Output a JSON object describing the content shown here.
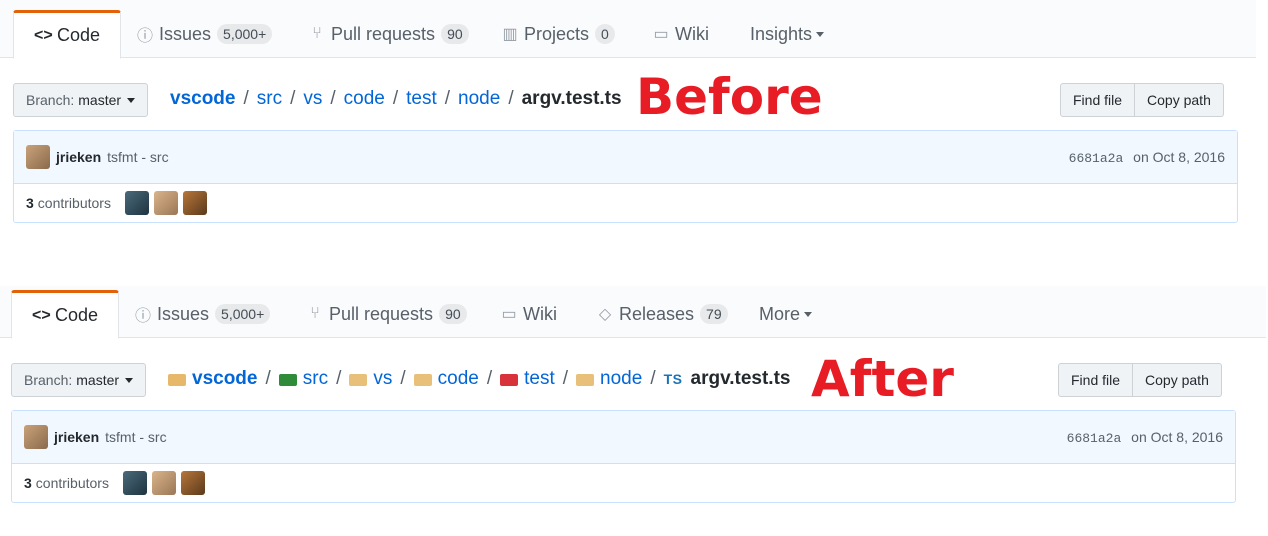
{
  "before": {
    "marker": "Before",
    "tabs": [
      {
        "label": "Code",
        "icon": "code-icon",
        "glyph": "<>",
        "counter": "",
        "selected": true
      },
      {
        "label": "Issues",
        "icon": "issue-icon",
        "glyph": "ⓘ",
        "counter": "5,000+"
      },
      {
        "label": "Pull requests",
        "icon": "pull-request-icon",
        "glyph": "⑂",
        "counter": "90"
      },
      {
        "label": "Projects",
        "icon": "project-icon",
        "glyph": "▥",
        "counter": "0"
      },
      {
        "label": "Wiki",
        "icon": "book-icon",
        "glyph": "▭",
        "counter": ""
      },
      {
        "label": "Insights",
        "icon": "",
        "glyph": "",
        "counter": "",
        "dropdown": true
      }
    ],
    "branch": {
      "prefix": "Branch:",
      "name": "master"
    },
    "breadcrumb": [
      "vscode",
      "src",
      "vs",
      "code",
      "test",
      "node"
    ],
    "file": "argv.test.ts",
    "buttons": {
      "find_file": "Find file",
      "copy_path": "Copy path"
    },
    "commit": {
      "author": "jrieken",
      "message": "tsfmt - src",
      "sha": "6681a2a",
      "date": "on Oct 8, 2016"
    },
    "contributors": {
      "count": "3",
      "label": "contributors"
    }
  },
  "after": {
    "marker": "After",
    "tabs": [
      {
        "label": "Code",
        "icon": "code-icon",
        "glyph": "<>",
        "counter": "",
        "selected": true
      },
      {
        "label": "Issues",
        "icon": "issue-icon",
        "glyph": "ⓘ",
        "counter": "5,000+"
      },
      {
        "label": "Pull requests",
        "icon": "pull-request-icon",
        "glyph": "⑂",
        "counter": "90"
      },
      {
        "label": "Wiki",
        "icon": "book-icon",
        "glyph": "▭",
        "counter": ""
      },
      {
        "label": "Releases",
        "icon": "tag-icon",
        "glyph": "◇",
        "counter": "79"
      },
      {
        "label": "More",
        "icon": "",
        "glyph": "",
        "counter": "",
        "dropdown": true
      }
    ],
    "branch": {
      "prefix": "Branch:",
      "name": "master"
    },
    "breadcrumb": [
      "vscode",
      "src",
      "vs",
      "code",
      "test",
      "node"
    ],
    "folder_icons": [
      "folder-vscode-icon",
      "folder-src-icon",
      "folder-icon",
      "folder-icon",
      "folder-test-icon",
      "folder-icon"
    ],
    "folder_colors": [
      "#e8b86a",
      "#2e8b3a",
      "#e8c07a",
      "#e8c07a",
      "#d8333a",
      "#e8c07a"
    ],
    "file_icon_text": "TS",
    "file": "argv.test.ts",
    "buttons": {
      "find_file": "Find file",
      "copy_path": "Copy path"
    },
    "commit": {
      "author": "jrieken",
      "message": "tsfmt - src",
      "sha": "6681a2a",
      "date": "on Oct 8, 2016"
    },
    "contributors": {
      "count": "3",
      "label": "contributors"
    }
  },
  "colors": {
    "accent": "#e36209",
    "link": "#0366d6",
    "marker": "#e81c24"
  }
}
